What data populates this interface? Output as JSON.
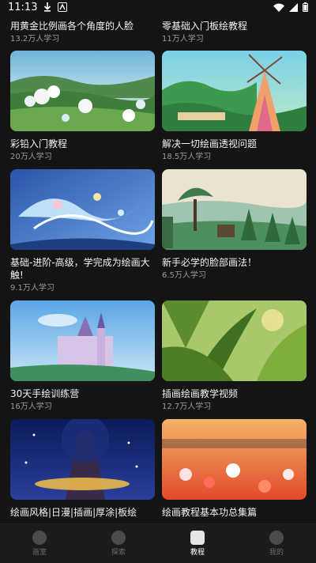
{
  "status": {
    "time": "11:13"
  },
  "top_items": [
    {
      "title": "用黄金比例画各个角度的人脸",
      "meta": "13.2万人学习"
    },
    {
      "title": "零基础入门板绘教程",
      "meta": "11万人学习"
    }
  ],
  "cards": [
    {
      "title": "彩铅入门教程",
      "meta": "20万人学习",
      "thumb": "landscape-flowers"
    },
    {
      "title": "解决一切绘画透视问题",
      "meta": "18.5万人学习",
      "thumb": "windmill"
    },
    {
      "title": "基础-进阶-高级，学完成为绘画大触!",
      "meta": "9.1万人学习",
      "thumb": "blue-splash"
    },
    {
      "title": "新手必学的脸部画法！",
      "meta": "6.5万人学习",
      "thumb": "house-trees"
    },
    {
      "title": "30天手绘训练营",
      "meta": "16万人学习",
      "thumb": "castle"
    },
    {
      "title": "插画绘画教学视频",
      "meta": "12.7万人学习",
      "thumb": "jungle"
    },
    {
      "title": "绘画风格|日漫|插画|厚涂|板绘",
      "meta": "",
      "thumb": "night-tree"
    },
    {
      "title": "绘画教程基本功总集篇",
      "meta": "",
      "thumb": "red-flowers"
    }
  ],
  "tabs": [
    {
      "label": "画室",
      "icon": "palette-icon",
      "active": false
    },
    {
      "label": "探索",
      "icon": "explore-icon",
      "active": false
    },
    {
      "label": "教程",
      "icon": "video-icon",
      "active": true
    },
    {
      "label": "我的",
      "icon": "profile-icon",
      "active": false
    }
  ]
}
